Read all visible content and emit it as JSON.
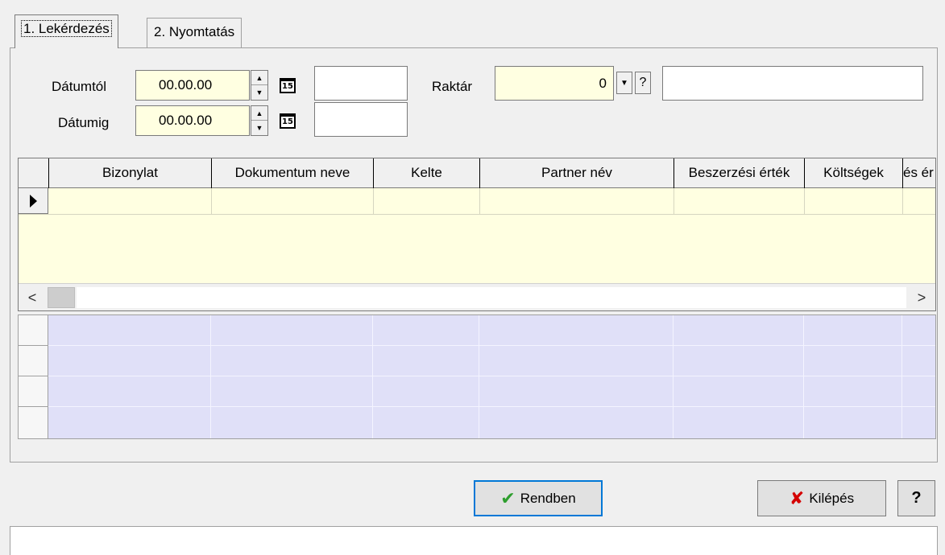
{
  "tabs": [
    {
      "label": "1. Lekérdezés",
      "active": true
    },
    {
      "label": "2. Nyomtatás",
      "active": false
    }
  ],
  "filters": {
    "date_from_label": "Dátumtól",
    "date_from_value": "00.00.00",
    "date_to_label": "Dátumig",
    "date_to_value": "00.00.00",
    "calendar_day": "15",
    "warehouse_label": "Raktár",
    "warehouse_value": "0",
    "lookup_label": "?"
  },
  "grid": {
    "columns": [
      "Bizonylat",
      "Dokumentum neve",
      "Kelte",
      "Partner név",
      "Beszerzési érték",
      "Költségek",
      "és ér"
    ]
  },
  "buttons": {
    "ok_label": "Rendben",
    "exit_label": "Kilépés",
    "help_label": "?"
  },
  "colors": {
    "input_yellow": "#ffffe1",
    "summary_blue": "#e0e0f8",
    "ok_check": "#2e9e2e",
    "exit_x": "#d40000"
  },
  "icons": [
    "spin-up-icon",
    "spin-down-icon",
    "calendar-icon",
    "dropdown-arrow-icon",
    "row-pointer-icon",
    "scroll-left-icon",
    "scroll-right-icon",
    "check-icon",
    "x-icon"
  ]
}
